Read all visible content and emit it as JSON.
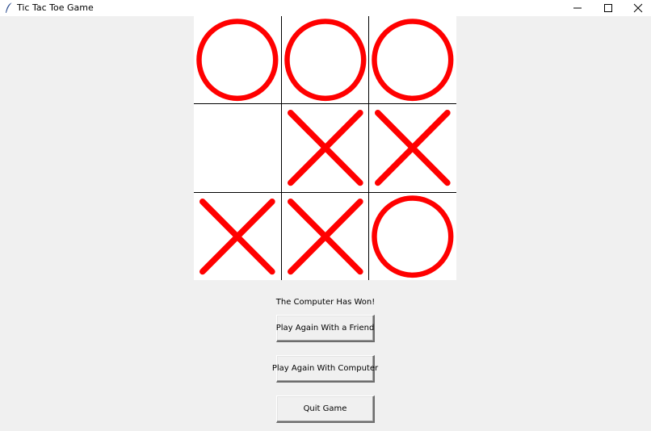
{
  "window": {
    "title": "Tic Tac Toe Game",
    "icon": "feather-icon",
    "controls": [
      "minimize-icon",
      "maximize-icon",
      "close-icon"
    ]
  },
  "board": {
    "cells": [
      [
        "O",
        "O",
        "O"
      ],
      [
        "",
        "X",
        "X"
      ],
      [
        "X",
        "X",
        "O"
      ]
    ],
    "mark_color": "#ff0000",
    "grid_color": "#000000",
    "cell_background": "#ffffff"
  },
  "status": {
    "message": "The Computer Has Won!"
  },
  "buttons": {
    "play_friend_label": "Play Again With a Friend",
    "play_computer_label": "Play Again With Computer",
    "quit_label": "Quit Game"
  }
}
